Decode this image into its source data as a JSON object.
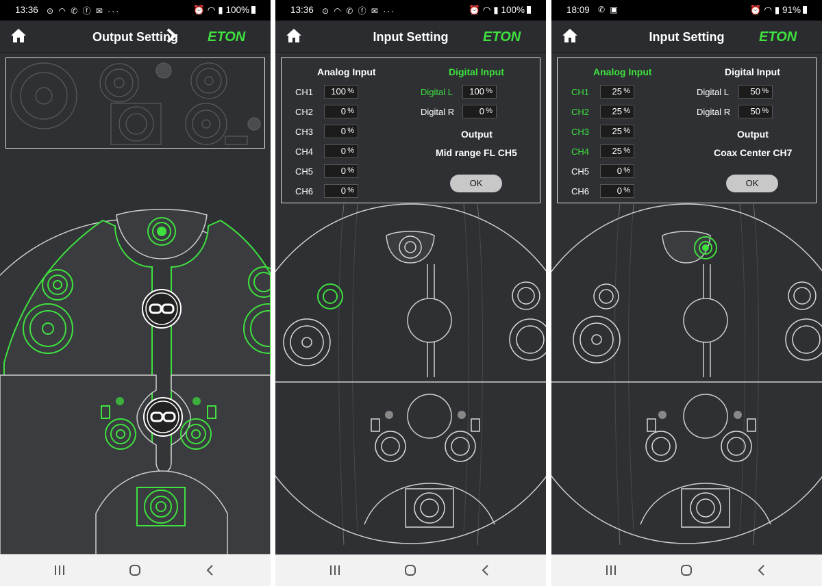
{
  "screens": [
    {
      "status": {
        "time": "13:36",
        "left_icons": "⊙ ◠ ✆ ⓕ ✉ ···",
        "right": "⏰ ◠ ▮ 100%"
      },
      "title": "Output Setting",
      "logo": "ETON",
      "link_icons": [
        "link-icon",
        "link-icon"
      ]
    },
    {
      "status": {
        "time": "13:36",
        "left_icons": "⊙ ◠ ✆ ⓕ ✉ ···",
        "right": "⏰ ◠ ▮ 100%"
      },
      "title": "Input Setting",
      "logo": "ETON",
      "analog_header": "Analog Input",
      "digital_header": "Digital Input",
      "channels": [
        {
          "label": "CH1",
          "value": "100"
        },
        {
          "label": "CH2",
          "value": "0"
        },
        {
          "label": "CH3",
          "value": "0"
        },
        {
          "label": "CH4",
          "value": "0"
        },
        {
          "label": "CH5",
          "value": "0"
        },
        {
          "label": "CH6",
          "value": "0"
        }
      ],
      "digital": [
        {
          "label": "Digital L",
          "value": "100"
        },
        {
          "label": "Digital R",
          "value": "0"
        }
      ],
      "unit": "%",
      "output_label": "Output",
      "output_value": "Mid range FL CH5",
      "ok_label": "OK"
    },
    {
      "status": {
        "time": "18:09",
        "left_icons": "✆ ▣",
        "right": "⏰ ◠ ▮ 91%"
      },
      "title": "Input Setting",
      "logo": "ETON",
      "analog_header": "Analog Input",
      "digital_header": "Digital Input",
      "channels": [
        {
          "label": "CH1",
          "value": "25"
        },
        {
          "label": "CH2",
          "value": "25"
        },
        {
          "label": "CH3",
          "value": "25"
        },
        {
          "label": "CH4",
          "value": "25"
        },
        {
          "label": "CH5",
          "value": "0"
        },
        {
          "label": "CH6",
          "value": "0"
        }
      ],
      "digital": [
        {
          "label": "Digital L",
          "value": "50"
        },
        {
          "label": "Digital R",
          "value": "50"
        }
      ],
      "unit": "%",
      "output_label": "Output",
      "output_value": "Coax Center CH7",
      "ok_label": "OK"
    }
  ],
  "colors": {
    "accent_green": "#3fe03f",
    "bg": "#2e3033",
    "line": "#d8d8d8"
  },
  "nav": [
    "recents-icon",
    "home-circle-icon",
    "back-icon"
  ]
}
